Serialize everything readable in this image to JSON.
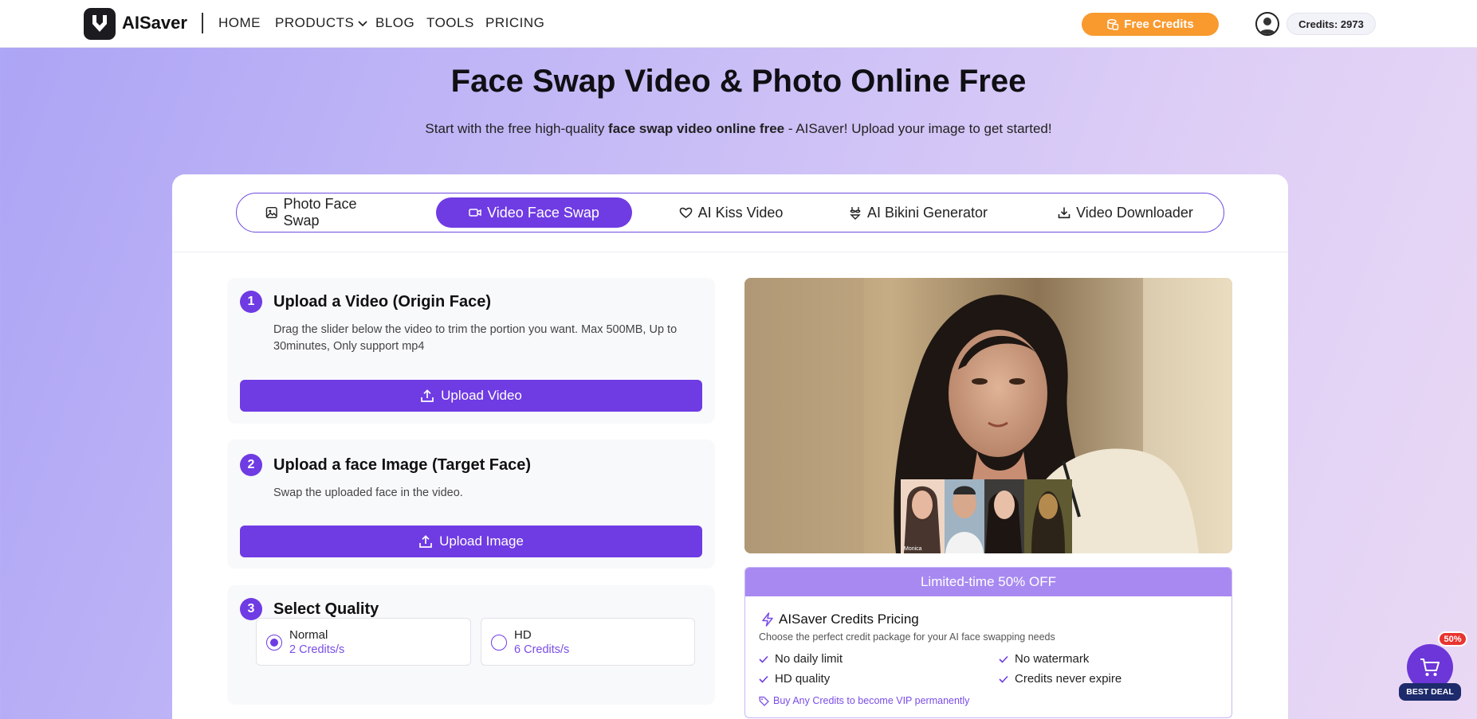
{
  "nav": {
    "brand": "AISaver",
    "items": [
      "HOME",
      "PRODUCTS",
      "BLOG",
      "TOOLS",
      "PRICING"
    ],
    "free_credits": "Free Credits",
    "credits": "Credits: 2973"
  },
  "hero": {
    "title": "Face Swap Video & Photo Online Free",
    "subtitle_pre": "Start with the free high-quality ",
    "subtitle_bold": "face swap video online free",
    "subtitle_post": " - AISaver! Upload your image to get started!"
  },
  "tabs": [
    {
      "label": "Photo Face Swap",
      "icon": "image-icon"
    },
    {
      "label": "Video Face Swap",
      "icon": "video-icon",
      "active": true
    },
    {
      "label": "AI Kiss Video",
      "icon": "heart-icon"
    },
    {
      "label": "AI Bikini Generator",
      "icon": "bikini-icon"
    },
    {
      "label": "Video Downloader",
      "icon": "download-icon"
    }
  ],
  "steps": [
    {
      "num": "1",
      "title": "Upload a Video (Origin Face)",
      "desc": "Drag the slider below the video to trim the portion you want. Max 500MB, Up to 30minutes, Only support mp4",
      "button": "Upload Video"
    },
    {
      "num": "2",
      "title": "Upload a face Image (Target Face)",
      "desc": "Swap the uploaded face in the video.",
      "button": "Upload Image"
    },
    {
      "num": "3",
      "title": "Select Quality"
    }
  ],
  "quality_options": [
    {
      "name": "Normal",
      "credits": "2 Credits/s",
      "selected": true
    },
    {
      "name": "HD",
      "credits": "6 Credits/s",
      "selected": false
    }
  ],
  "preview": {
    "caption": "Monica"
  },
  "pricing": {
    "banner": "Limited-time 50% OFF",
    "title": "AISaver Credits Pricing",
    "desc": "Choose the perfect credit package for your AI face swapping needs",
    "features": [
      "No daily limit",
      "No watermark",
      "HD quality",
      "Credits never expire"
    ],
    "vip": "Buy Any Credits to become VIP permanently"
  },
  "deal": {
    "badge": "50%",
    "label": "BEST DEAL"
  },
  "colors": {
    "accent": "#6f3be3",
    "orange": "#f99a2f",
    "promo": "#a889f1"
  }
}
